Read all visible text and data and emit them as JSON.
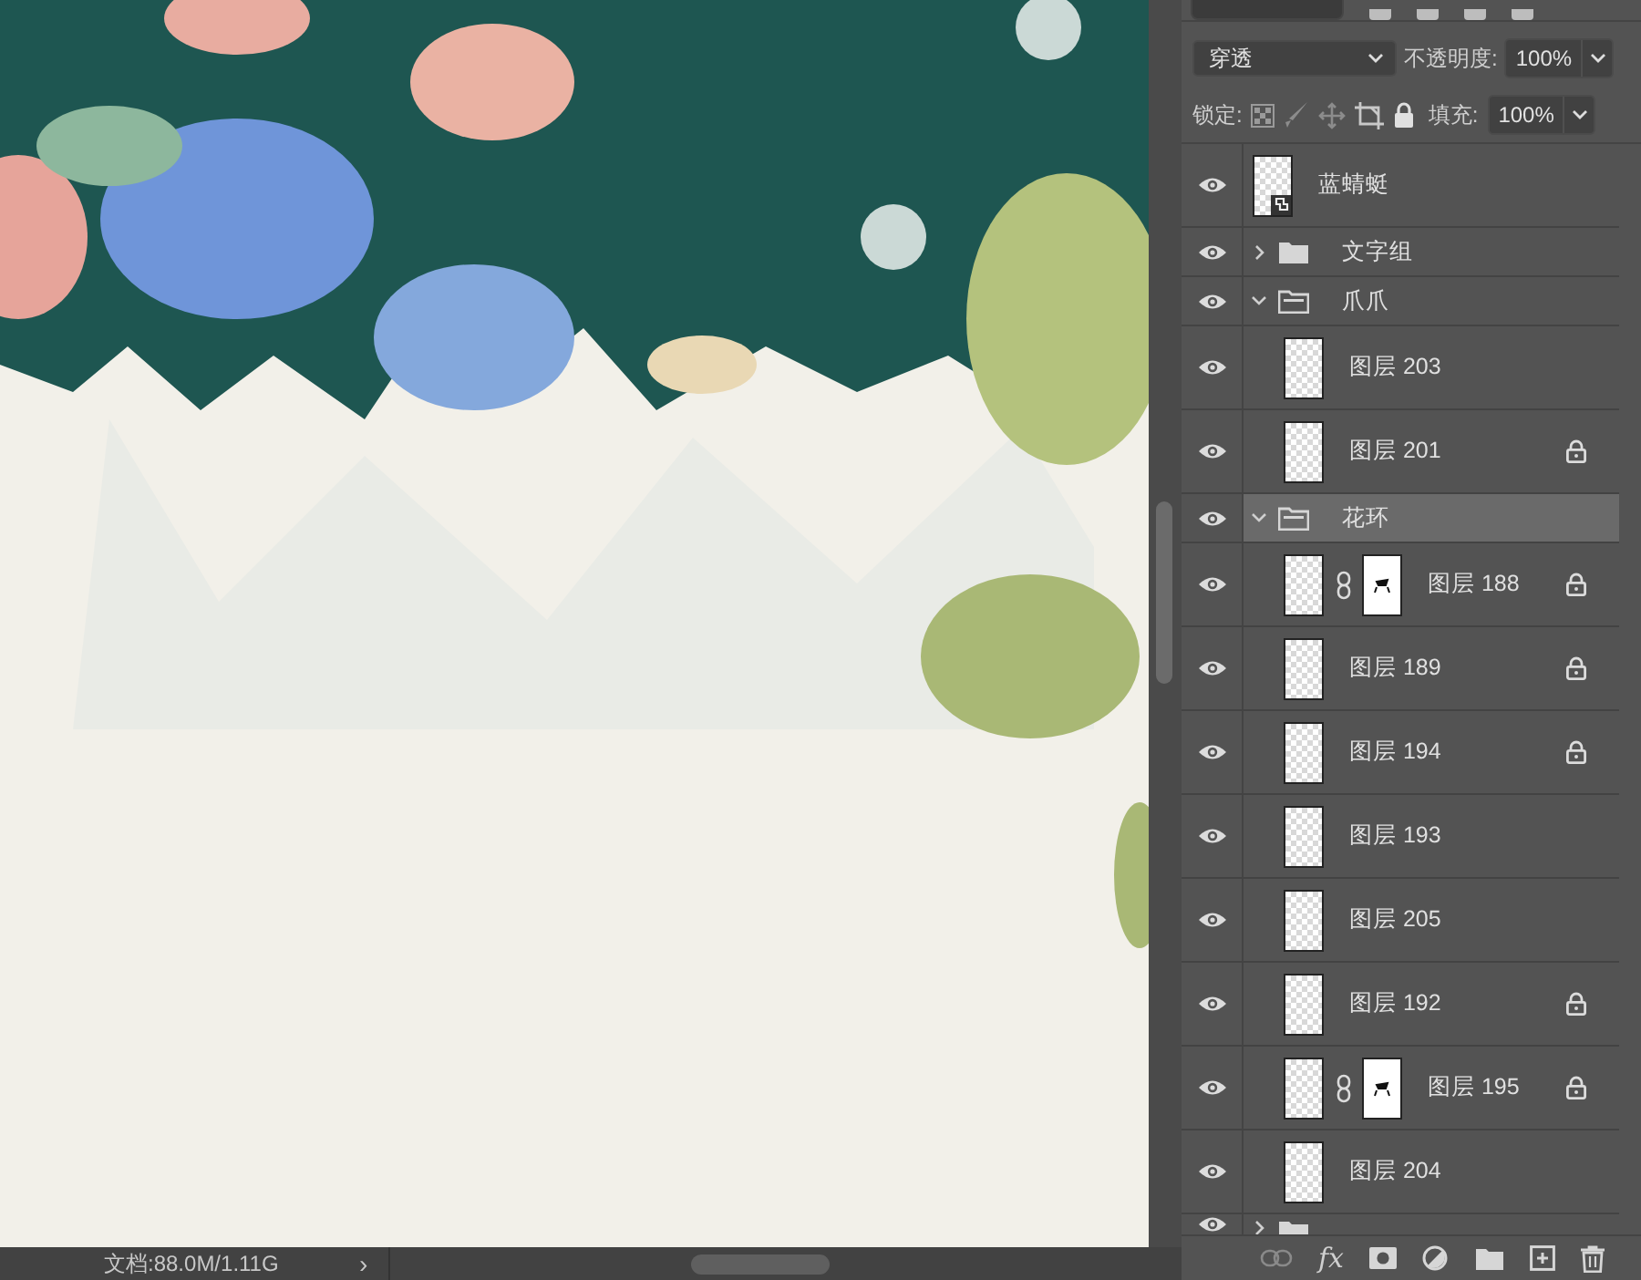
{
  "options": {
    "blend_mode": "穿透",
    "opacity_label": "不透明度:",
    "opacity": "100%",
    "lock_label": "锁定:",
    "fill_label": "填充:",
    "fill": "100%"
  },
  "layers": [
    {
      "kind": "smart",
      "name": "蓝蜻蜓",
      "visible": true,
      "selected": false
    },
    {
      "kind": "group",
      "name": "文字组",
      "visible": true,
      "selected": false,
      "expanded": false
    },
    {
      "kind": "group",
      "name": "爪爪",
      "visible": true,
      "selected": false,
      "expanded": true,
      "children": [
        {
          "kind": "layer",
          "name": "图层 203",
          "visible": true,
          "selected": false,
          "locked": false,
          "mask": false
        },
        {
          "kind": "layer",
          "name": "图层 201",
          "visible": true,
          "selected": false,
          "locked": true,
          "mask": false
        }
      ]
    },
    {
      "kind": "group",
      "name": "花环",
      "visible": true,
      "selected": true,
      "expanded": true,
      "children": [
        {
          "kind": "layer",
          "name": "图层 188",
          "visible": true,
          "selected": false,
          "locked": true,
          "mask": true
        },
        {
          "kind": "layer",
          "name": "图层 189",
          "visible": true,
          "selected": false,
          "locked": true,
          "mask": false
        },
        {
          "kind": "layer",
          "name": "图层 194",
          "visible": true,
          "selected": false,
          "locked": true,
          "mask": false
        },
        {
          "kind": "layer",
          "name": "图层 193",
          "visible": true,
          "selected": false,
          "locked": false,
          "mask": false
        },
        {
          "kind": "layer",
          "name": "图层 205",
          "visible": true,
          "selected": false,
          "locked": false,
          "mask": false
        },
        {
          "kind": "layer",
          "name": "图层 192",
          "visible": true,
          "selected": false,
          "locked": true,
          "mask": false
        },
        {
          "kind": "layer",
          "name": "图层 195",
          "visible": true,
          "selected": false,
          "locked": true,
          "mask": true
        },
        {
          "kind": "layer",
          "name": "图层 204",
          "visible": true,
          "selected": false,
          "locked": false,
          "mask": false
        }
      ]
    },
    {
      "kind": "group",
      "visible": true,
      "selected": false,
      "expanded": false
    }
  ],
  "toolbar": {
    "fx": "fx"
  },
  "status_bar": {
    "document": "文档:88.0M/1.11G",
    "arrow": "›"
  }
}
